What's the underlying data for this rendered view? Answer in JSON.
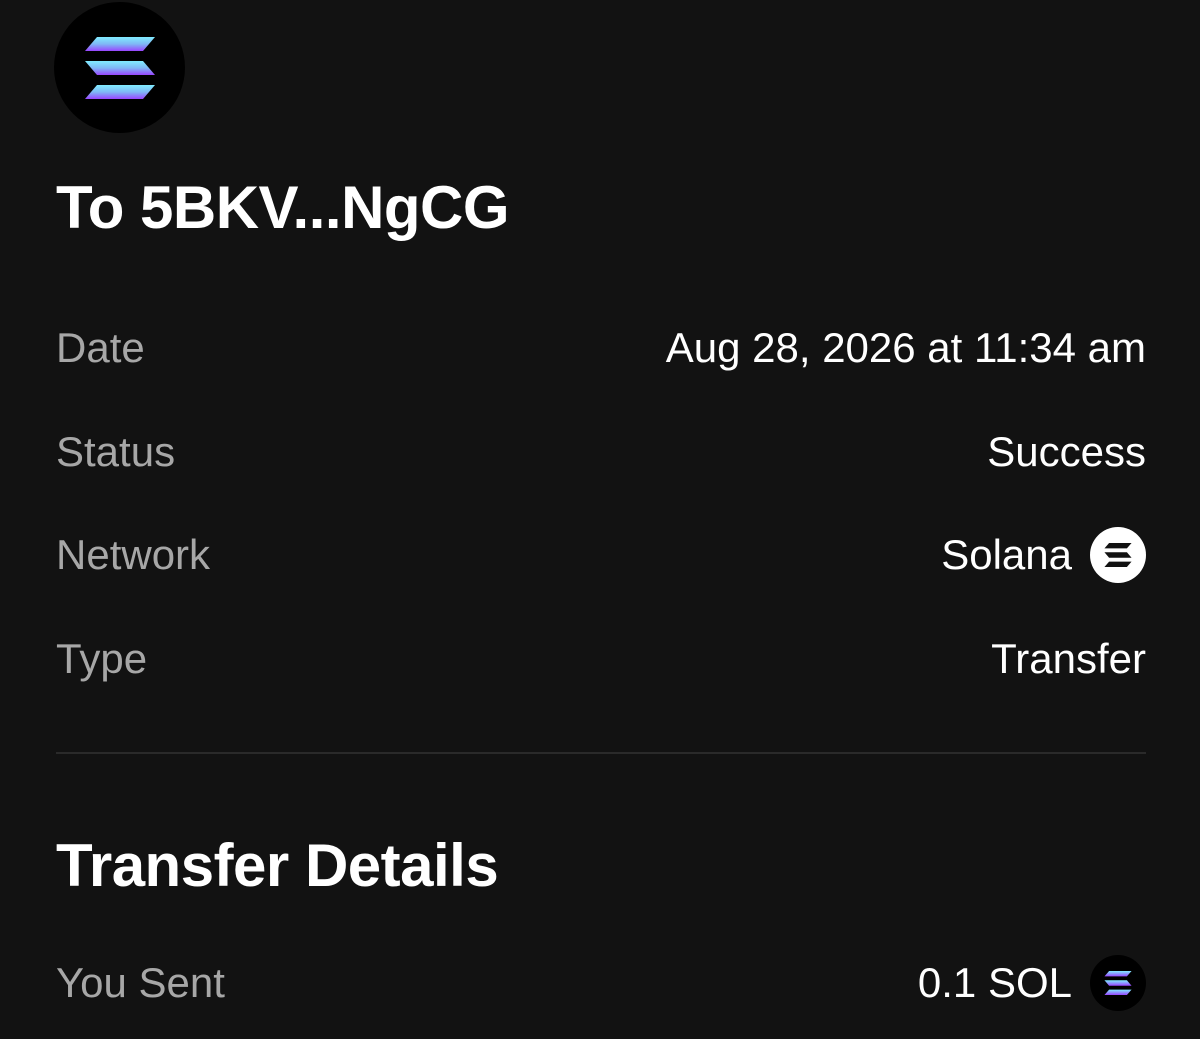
{
  "header": {
    "logo_icon": "solana-logo-icon",
    "title": "To 5BKV...NgCG"
  },
  "details": [
    {
      "label": "Date",
      "value": "Aug 28, 2026 at 11:34 am"
    },
    {
      "label": "Status",
      "value": "Success"
    },
    {
      "label": "Network",
      "value": "Solana",
      "icon": "solana-icon"
    },
    {
      "label": "Type",
      "value": "Transfer"
    }
  ],
  "transfer": {
    "section_title": "Transfer Details",
    "sent_label": "You Sent",
    "sent_value": "0.1 SOL",
    "sent_icon": "sol-token-icon"
  },
  "colors": {
    "background": "#121212",
    "label": "#a7a7a7",
    "value": "#ffffff",
    "solana_gradient_start": "#14F195",
    "solana_gradient_mid": "#80ECFF",
    "solana_gradient_end": "#9945FF"
  }
}
